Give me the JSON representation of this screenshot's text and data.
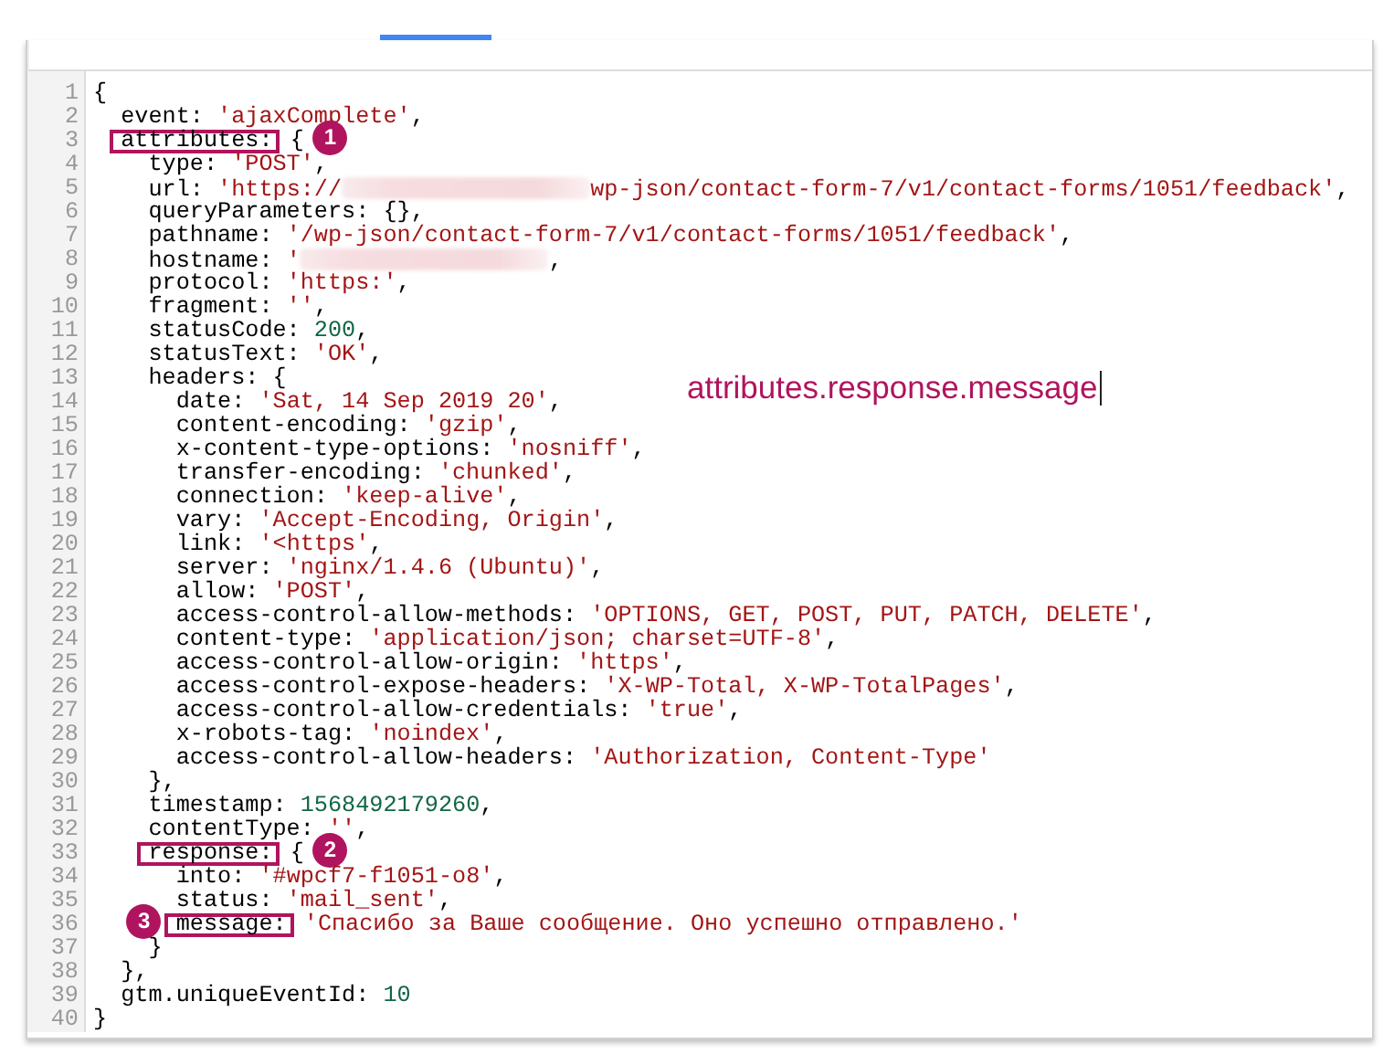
{
  "tabs": {
    "selected_indicator": true
  },
  "annotation": {
    "text": "attributes.response.message",
    "cursor": true
  },
  "lines": [
    {
      "number": "1",
      "tokens": [
        {
          "kind": "plain",
          "text": "{"
        }
      ]
    },
    {
      "number": "2",
      "tokens": [
        {
          "kind": "plain",
          "text": "  event: "
        },
        {
          "kind": "string",
          "text": "'ajaxComplete'"
        },
        {
          "kind": "plain",
          "text": ","
        }
      ]
    },
    {
      "number": "3",
      "tokens": [
        {
          "kind": "boxed",
          "text": "  attributes:",
          "callout": {
            "number": "1",
            "before": false
          }
        },
        {
          "kind": "plain",
          "text": " {"
        }
      ]
    },
    {
      "number": "4",
      "tokens": [
        {
          "kind": "plain",
          "text": "    type: "
        },
        {
          "kind": "string",
          "text": "'POST'"
        },
        {
          "kind": "plain",
          "text": ","
        }
      ]
    },
    {
      "number": "5",
      "tokens": [
        {
          "kind": "plain",
          "text": "    url: "
        },
        {
          "kind": "string",
          "text": "'https://"
        },
        {
          "kind": "redacted"
        },
        {
          "kind": "string",
          "text": "wp-json/contact-form-7/v1/contact-forms/1051/feedback'"
        },
        {
          "kind": "plain",
          "text": ","
        }
      ]
    },
    {
      "number": "6",
      "tokens": [
        {
          "kind": "plain",
          "text": "    queryParameters: {},"
        }
      ]
    },
    {
      "number": "7",
      "tokens": [
        {
          "kind": "plain",
          "text": "    pathname: "
        },
        {
          "kind": "string",
          "text": "'/wp-json/contact-form-7/v1/contact-forms/1051/feedback'"
        },
        {
          "kind": "plain",
          "text": ","
        }
      ]
    },
    {
      "number": "8",
      "tokens": [
        {
          "kind": "plain",
          "text": "    hostname: "
        },
        {
          "kind": "string",
          "text": "'"
        },
        {
          "kind": "redacted"
        },
        {
          "kind": "plain",
          "text": ","
        }
      ]
    },
    {
      "number": "9",
      "tokens": [
        {
          "kind": "plain",
          "text": "    protocol: "
        },
        {
          "kind": "string",
          "text": "'https:'"
        },
        {
          "kind": "plain",
          "text": ","
        }
      ]
    },
    {
      "number": "10",
      "tokens": [
        {
          "kind": "plain",
          "text": "    fragment: "
        },
        {
          "kind": "string",
          "text": "''"
        },
        {
          "kind": "plain",
          "text": ","
        }
      ]
    },
    {
      "number": "11",
      "tokens": [
        {
          "kind": "plain",
          "text": "    statusCode: "
        },
        {
          "kind": "number",
          "text": "200"
        },
        {
          "kind": "plain",
          "text": ","
        }
      ]
    },
    {
      "number": "12",
      "tokens": [
        {
          "kind": "plain",
          "text": "    statusText: "
        },
        {
          "kind": "string",
          "text": "'OK'"
        },
        {
          "kind": "plain",
          "text": ","
        }
      ]
    },
    {
      "number": "13",
      "tokens": [
        {
          "kind": "plain",
          "text": "    headers: {"
        }
      ]
    },
    {
      "number": "14",
      "tokens": [
        {
          "kind": "plain",
          "text": "      date: "
        },
        {
          "kind": "string",
          "text": "'Sat, 14 Sep 2019 20'"
        },
        {
          "kind": "plain",
          "text": ","
        }
      ]
    },
    {
      "number": "15",
      "tokens": [
        {
          "kind": "plain",
          "text": "      content-encoding: "
        },
        {
          "kind": "string",
          "text": "'gzip'"
        },
        {
          "kind": "plain",
          "text": ","
        }
      ]
    },
    {
      "number": "16",
      "tokens": [
        {
          "kind": "plain",
          "text": "      x-content-type-options: "
        },
        {
          "kind": "string",
          "text": "'nosniff'"
        },
        {
          "kind": "plain",
          "text": ","
        }
      ]
    },
    {
      "number": "17",
      "tokens": [
        {
          "kind": "plain",
          "text": "      transfer-encoding: "
        },
        {
          "kind": "string",
          "text": "'chunked'"
        },
        {
          "kind": "plain",
          "text": ","
        }
      ]
    },
    {
      "number": "18",
      "tokens": [
        {
          "kind": "plain",
          "text": "      connection: "
        },
        {
          "kind": "string",
          "text": "'keep-alive'"
        },
        {
          "kind": "plain",
          "text": ","
        }
      ]
    },
    {
      "number": "19",
      "tokens": [
        {
          "kind": "plain",
          "text": "      vary: "
        },
        {
          "kind": "string",
          "text": "'Accept-Encoding, Origin'"
        },
        {
          "kind": "plain",
          "text": ","
        }
      ]
    },
    {
      "number": "20",
      "tokens": [
        {
          "kind": "plain",
          "text": "      link: "
        },
        {
          "kind": "string",
          "text": "'<https'"
        },
        {
          "kind": "plain",
          "text": ","
        }
      ]
    },
    {
      "number": "21",
      "tokens": [
        {
          "kind": "plain",
          "text": "      server: "
        },
        {
          "kind": "string",
          "text": "'nginx/1.4.6 (Ubuntu)'"
        },
        {
          "kind": "plain",
          "text": ","
        }
      ]
    },
    {
      "number": "22",
      "tokens": [
        {
          "kind": "plain",
          "text": "      allow: "
        },
        {
          "kind": "string",
          "text": "'POST'"
        },
        {
          "kind": "plain",
          "text": ","
        }
      ]
    },
    {
      "number": "23",
      "tokens": [
        {
          "kind": "plain",
          "text": "      access-control-allow-methods: "
        },
        {
          "kind": "string",
          "text": "'OPTIONS, GET, POST, PUT, PATCH, DELETE'"
        },
        {
          "kind": "plain",
          "text": ","
        }
      ]
    },
    {
      "number": "24",
      "tokens": [
        {
          "kind": "plain",
          "text": "      content-type: "
        },
        {
          "kind": "string",
          "text": "'application/json; charset=UTF-8'"
        },
        {
          "kind": "plain",
          "text": ","
        }
      ]
    },
    {
      "number": "25",
      "tokens": [
        {
          "kind": "plain",
          "text": "      access-control-allow-origin: "
        },
        {
          "kind": "string",
          "text": "'https'"
        },
        {
          "kind": "plain",
          "text": ","
        }
      ]
    },
    {
      "number": "26",
      "tokens": [
        {
          "kind": "plain",
          "text": "      access-control-expose-headers: "
        },
        {
          "kind": "string",
          "text": "'X-WP-Total, X-WP-TotalPages'"
        },
        {
          "kind": "plain",
          "text": ","
        }
      ]
    },
    {
      "number": "27",
      "tokens": [
        {
          "kind": "plain",
          "text": "      access-control-allow-credentials: "
        },
        {
          "kind": "string",
          "text": "'true'"
        },
        {
          "kind": "plain",
          "text": ","
        }
      ]
    },
    {
      "number": "28",
      "tokens": [
        {
          "kind": "plain",
          "text": "      x-robots-tag: "
        },
        {
          "kind": "string",
          "text": "'noindex'"
        },
        {
          "kind": "plain",
          "text": ","
        }
      ]
    },
    {
      "number": "29",
      "tokens": [
        {
          "kind": "plain",
          "text": "      access-control-allow-headers: "
        },
        {
          "kind": "string",
          "text": "'Authorization, Content-Type'"
        }
      ]
    },
    {
      "number": "30",
      "tokens": [
        {
          "kind": "plain",
          "text": "    },"
        }
      ]
    },
    {
      "number": "31",
      "tokens": [
        {
          "kind": "plain",
          "text": "    timestamp: "
        },
        {
          "kind": "number",
          "text": "1568492179260"
        },
        {
          "kind": "plain",
          "text": ","
        }
      ]
    },
    {
      "number": "32",
      "tokens": [
        {
          "kind": "plain",
          "text": "    contentType: "
        },
        {
          "kind": "string",
          "text": "''"
        },
        {
          "kind": "plain",
          "text": ","
        }
      ]
    },
    {
      "number": "33",
      "tokens": [
        {
          "kind": "boxed",
          "text": "    response:",
          "callout": {
            "number": "2",
            "before": false
          }
        },
        {
          "kind": "plain",
          "text": " {"
        }
      ]
    },
    {
      "number": "34",
      "tokens": [
        {
          "kind": "plain",
          "text": "      into: "
        },
        {
          "kind": "string",
          "text": "'#wpcf7-f1051-o8'"
        },
        {
          "kind": "plain",
          "text": ","
        }
      ]
    },
    {
      "number": "35",
      "tokens": [
        {
          "kind": "plain",
          "text": "      status: "
        },
        {
          "kind": "string",
          "text": "'mail_sent'"
        },
        {
          "kind": "plain",
          "text": ","
        }
      ]
    },
    {
      "number": "36",
      "tokens": [
        {
          "kind": "boxed",
          "text": "      message:",
          "callout": {
            "number": "3",
            "before": true
          }
        },
        {
          "kind": "string",
          "text": " 'Спасибо за Ваше сообщение. Оно успешно отправлено.'"
        }
      ]
    },
    {
      "number": "37",
      "tokens": [
        {
          "kind": "plain",
          "text": "    }"
        }
      ]
    },
    {
      "number": "38",
      "tokens": [
        {
          "kind": "plain",
          "text": "  },"
        }
      ]
    },
    {
      "number": "39",
      "tokens": [
        {
          "kind": "plain",
          "text": "  gtm.uniqueEventId: "
        },
        {
          "kind": "number",
          "text": "10"
        }
      ]
    },
    {
      "number": "40",
      "tokens": [
        {
          "kind": "plain",
          "text": "}"
        }
      ]
    }
  ]
}
